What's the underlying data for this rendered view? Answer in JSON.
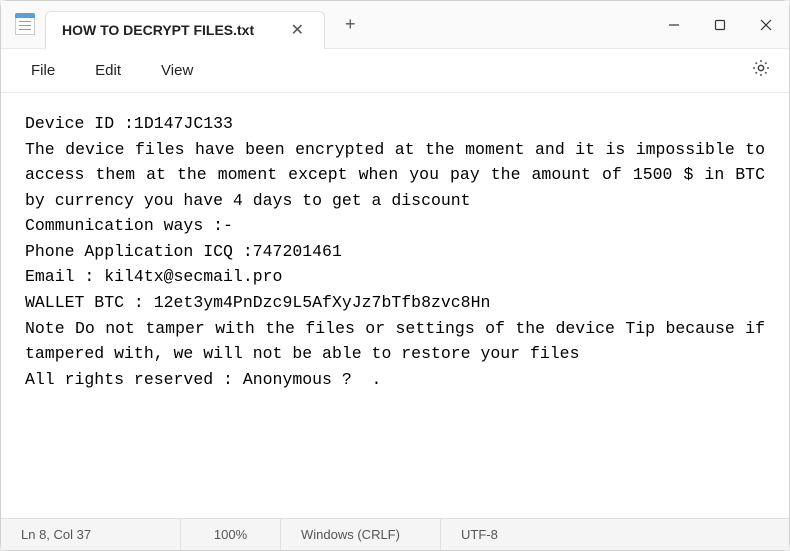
{
  "titlebar": {
    "tab_title": "HOW TO DECRYPT FILES.txt",
    "close_glyph": "✕",
    "new_tab_glyph": "+"
  },
  "window_controls": {
    "minimize": "—",
    "maximize": "☐",
    "close": "✕"
  },
  "menubar": {
    "file": "File",
    "edit": "Edit",
    "view": "View"
  },
  "content": {
    "text": "Device ID :1D147JC133\nThe device files have been encrypted at the moment and it is impossible to access them at the moment except when you pay the amount of 1500 $ in BTC by currency you have 4 days to get a discount\nCommunication ways :-\nPhone Application ICQ :747201461\nEmail : kil4tx@secmail.pro\nWALLET BTC : 12et3ym4PnDzc9L5AfXyJz7bTfb8zvc8Hn\nNote Do not tamper with the files or settings of the device Tip because if tampered with, we will not be able to restore your files\nAll rights reserved : Anonymous ?  ."
  },
  "statusbar": {
    "position": "Ln 8, Col 37",
    "zoom": "100%",
    "line_ending": "Windows (CRLF)",
    "encoding": "UTF-8"
  }
}
